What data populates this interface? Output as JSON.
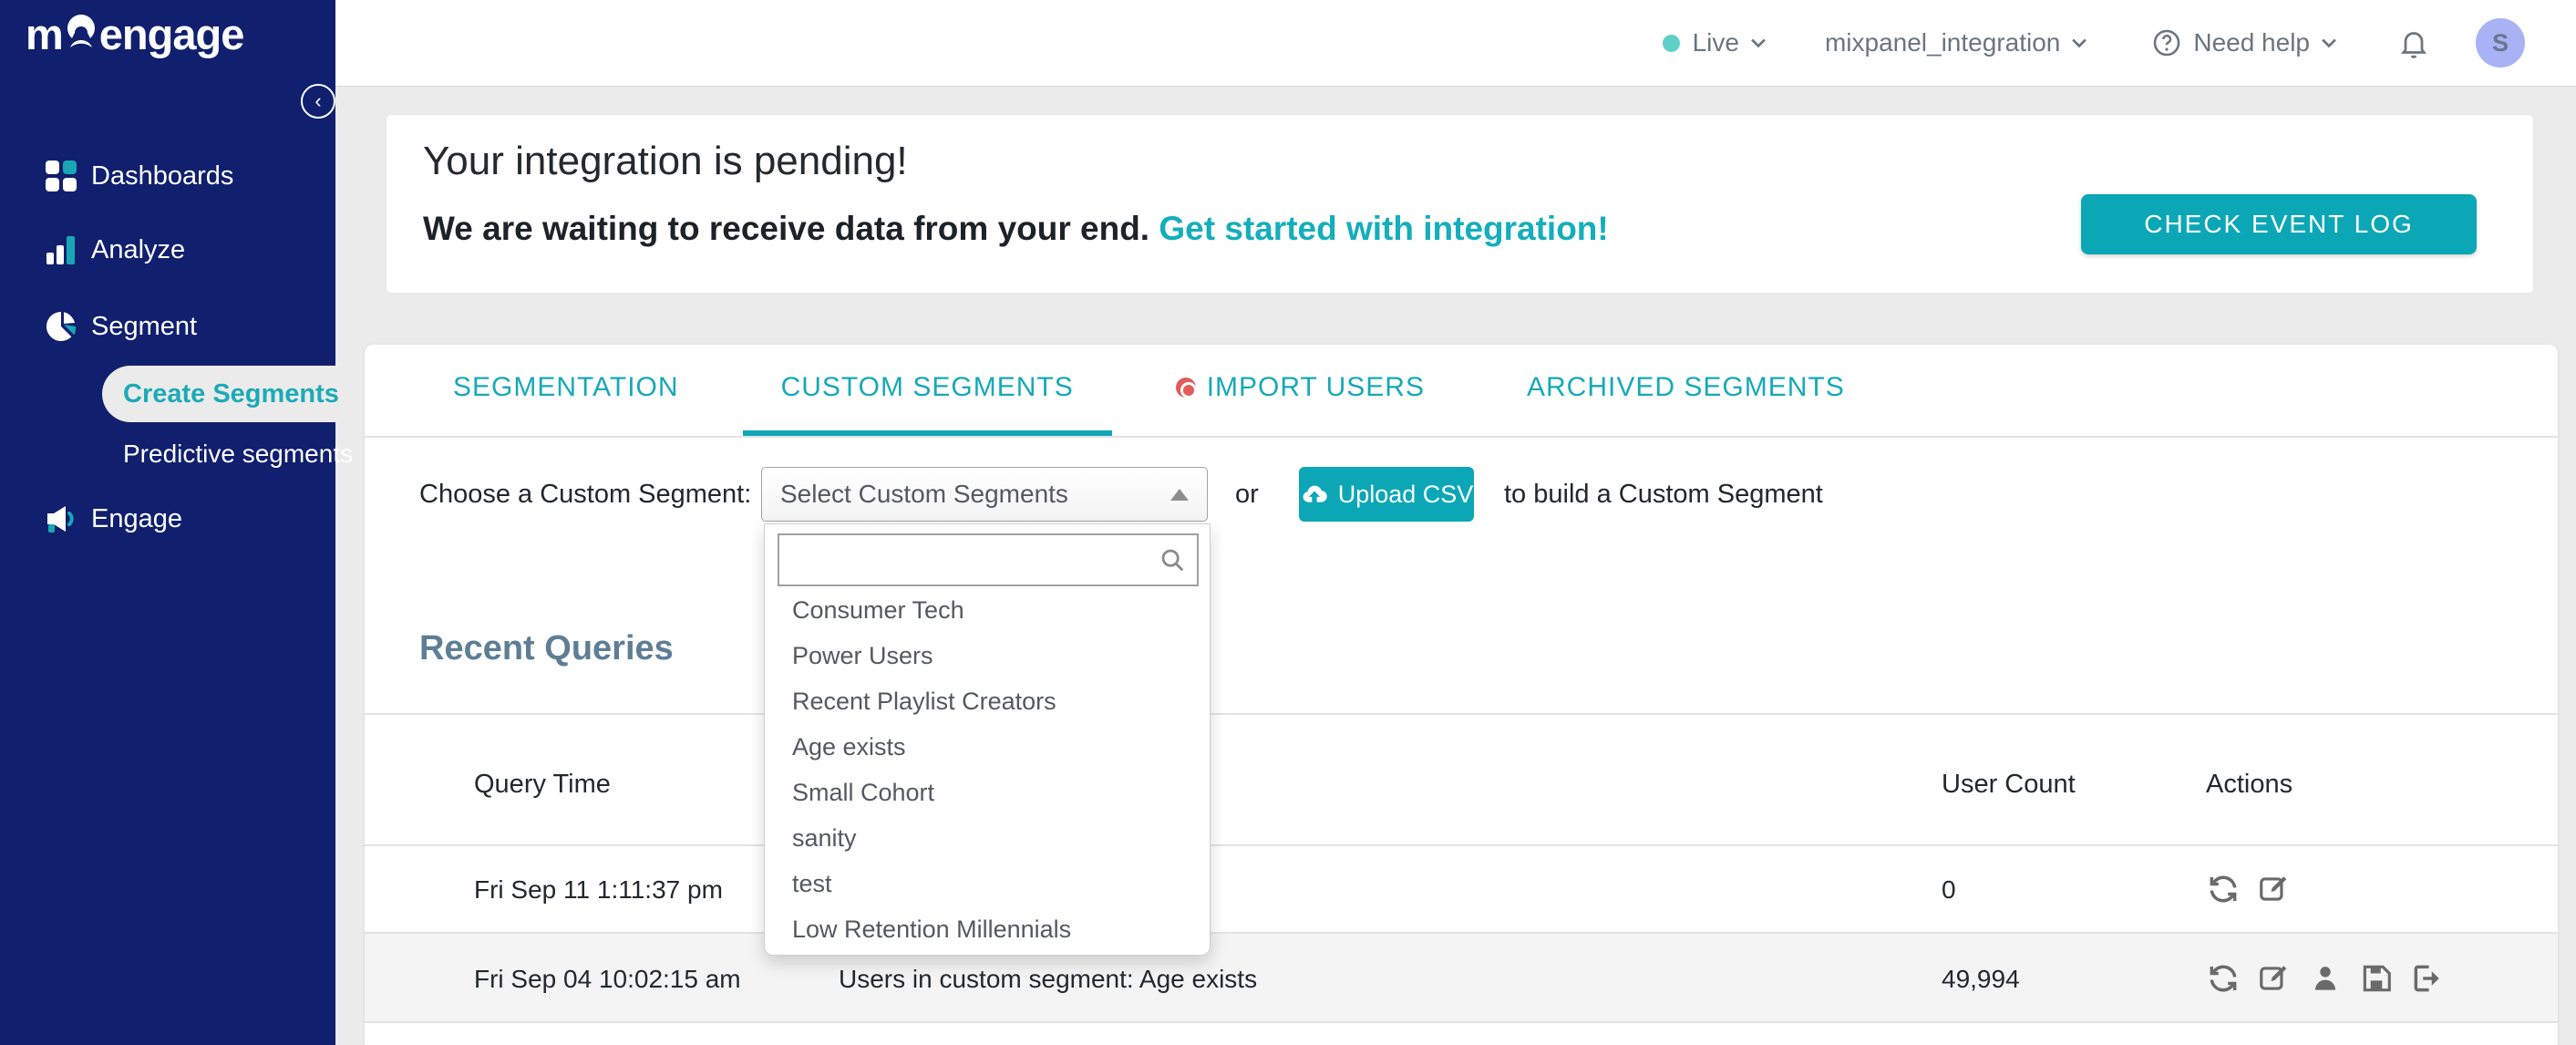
{
  "colors": {
    "navy": "#101f6e",
    "teal": "#0ca7b6",
    "link_teal": "#14aebc",
    "live_dot": "#5fd0c6",
    "heading_slate": "#5e7e95",
    "import_dot_red": "#e25b5b",
    "avatar_bg": "#a9b2f4",
    "page_bg": "#ebebeb",
    "row_alt_bg": "#f4f4f4"
  },
  "sidebar": {
    "logo_text_start": "m",
    "logo_text_end": "engage",
    "items": [
      {
        "label": "Dashboards"
      },
      {
        "label": "Analyze"
      },
      {
        "label": "Segment"
      },
      {
        "label": "Engage"
      }
    ],
    "segment_children": [
      {
        "label": "Create Segments"
      },
      {
        "label": "Predictive segments"
      }
    ]
  },
  "topbar": {
    "environment": "Live",
    "project": "mixpanel_integration",
    "help": "Need help",
    "avatar_initial": "S"
  },
  "banner": {
    "title": "Your integration is pending!",
    "message": "We are waiting to receive data from your end. ",
    "link": "Get started with integration!",
    "button": "CHECK EVENT LOG"
  },
  "tabs": {
    "items": [
      {
        "label": "SEGMENTATION"
      },
      {
        "label": "CUSTOM SEGMENTS"
      },
      {
        "label": "IMPORT USERS"
      },
      {
        "label": "ARCHIVED SEGMENTS"
      }
    ]
  },
  "chooser": {
    "label": "Choose a Custom Segment:",
    "select_value": "Select Custom Segments",
    "or_text": "or",
    "upload_button": "Upload CSV",
    "suffix": "to build a Custom Segment"
  },
  "dropdown": {
    "items": [
      "Consumer Tech",
      "Power Users",
      "Recent Playlist Creators",
      "Age exists",
      "Small Cohort",
      "sanity",
      "test",
      "Low Retention Millennials"
    ]
  },
  "recent_queries": {
    "title": "Recent Queries",
    "columns": {
      "time": "Query Time",
      "count": "User Count",
      "actions": "Actions"
    },
    "rows": [
      {
        "time": "Fri Sep 11 1:11:37 pm",
        "query": "",
        "count": "0"
      },
      {
        "time": "Fri Sep 04 10:02:15 am",
        "query": "Users in custom segment: Age exists",
        "count": "49,994"
      }
    ]
  }
}
